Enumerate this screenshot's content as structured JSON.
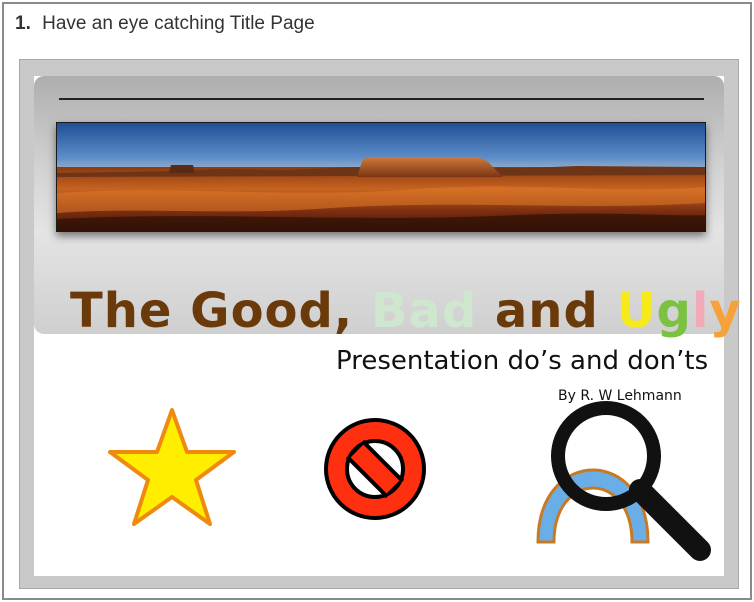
{
  "step": {
    "number": "1.",
    "text": "Have an eye catching Title Page"
  },
  "slide": {
    "title": [
      {
        "text": "The Good, ",
        "color": "#6b3a0b"
      },
      {
        "text": "Bad",
        "color": "#cfe6cf"
      },
      {
        "text": " and ",
        "color": "#6b3a0b"
      },
      {
        "text": "U",
        "color": "#f6ea1a"
      },
      {
        "text": "g",
        "color": "#7cc242"
      },
      {
        "text": "l",
        "color": "#f2a9b8"
      },
      {
        "text": "y",
        "color": "#f7a13a"
      }
    ],
    "subtitle": "Presentation do’s and don’ts",
    "byline": "By R. W Lehmann"
  },
  "icons": {
    "photo": "desert-mesa-landscape",
    "star": "star-icon",
    "prohibited": "no-symbol-icon",
    "rainbow": "rainbow-arc-icon",
    "magnifier": "magnifying-glass-icon"
  },
  "colors": {
    "star_fill": "#ffee00",
    "star_stroke": "#ee8a10",
    "prohibited_red": "#ff3010",
    "rainbow_blue": "#6aaee8",
    "rainbow_outline": "#c87a22"
  }
}
